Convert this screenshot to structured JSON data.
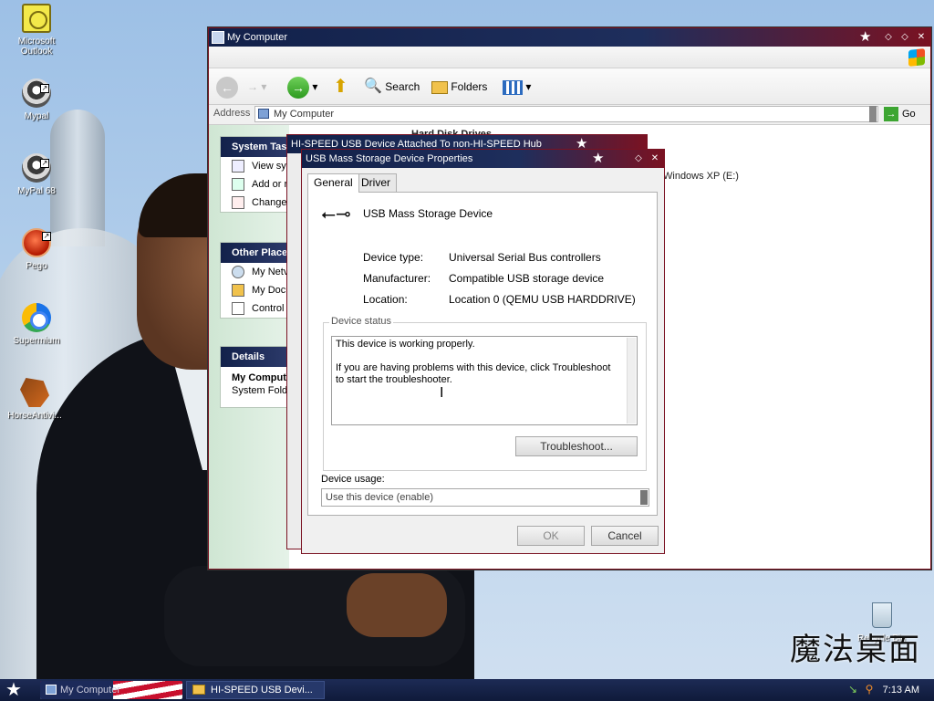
{
  "desktop": {
    "icons": [
      {
        "label": "Microsoft Outlook",
        "icon": "outlook-icon"
      },
      {
        "label": "Mypal",
        "icon": "raccoon-icon"
      },
      {
        "label": "MyPal 68",
        "icon": "raccoon-icon"
      },
      {
        "label": "Pego",
        "icon": "pego-icon"
      },
      {
        "label": "Supermium",
        "icon": "supermium-icon"
      },
      {
        "label": "HorseAntivi...",
        "icon": "horse-icon"
      }
    ],
    "recycle_bin": "Recycle Bin",
    "brand_text": "魔法桌面"
  },
  "my_computer": {
    "title": "My Computer",
    "toolbar": {
      "search": "Search",
      "folders": "Folders"
    },
    "address_label": "Address",
    "address_value": "My Computer",
    "go_label": "Go",
    "sections": {
      "system_tasks": "System Tas",
      "other_places": "Other Place",
      "details": "Details"
    },
    "system_tasks": [
      "View sy",
      "Add or r",
      "Change"
    ],
    "other_places": [
      "My Netv",
      "My Docu",
      "Control I"
    ],
    "details": {
      "name": "My Comput",
      "type": "System Folde"
    },
    "heading": "Hard Disk Drives",
    "drive": "Windows XP (E:)"
  },
  "hispeed_dialog": {
    "title": "HI-SPEED USB Device Attached To non-HI-SPEED Hub"
  },
  "properties": {
    "title": "USB Mass Storage Device Properties",
    "tabs": [
      "General",
      "Driver"
    ],
    "device_name": "USB Mass Storage Device",
    "rows": [
      {
        "label": "Device type:",
        "value": "Universal Serial Bus controllers"
      },
      {
        "label": "Manufacturer:",
        "value": "Compatible USB storage device"
      },
      {
        "label": "Location:",
        "value": "Location 0 (QEMU USB HARDDRIVE)"
      }
    ],
    "status_legend": "Device status",
    "status_line1": "This device is working properly.",
    "status_line2": "If you are having problems with this device, click Troubleshoot to start the troubleshooter.",
    "troubleshoot": "Troubleshoot...",
    "usage_label": "Device usage:",
    "usage_value": "Use this device (enable)",
    "ok": "OK",
    "cancel": "Cancel"
  },
  "taskbar": {
    "items": [
      "My Computer",
      "HI-SPEED USB Devi..."
    ],
    "clock": "7:13 AM"
  }
}
